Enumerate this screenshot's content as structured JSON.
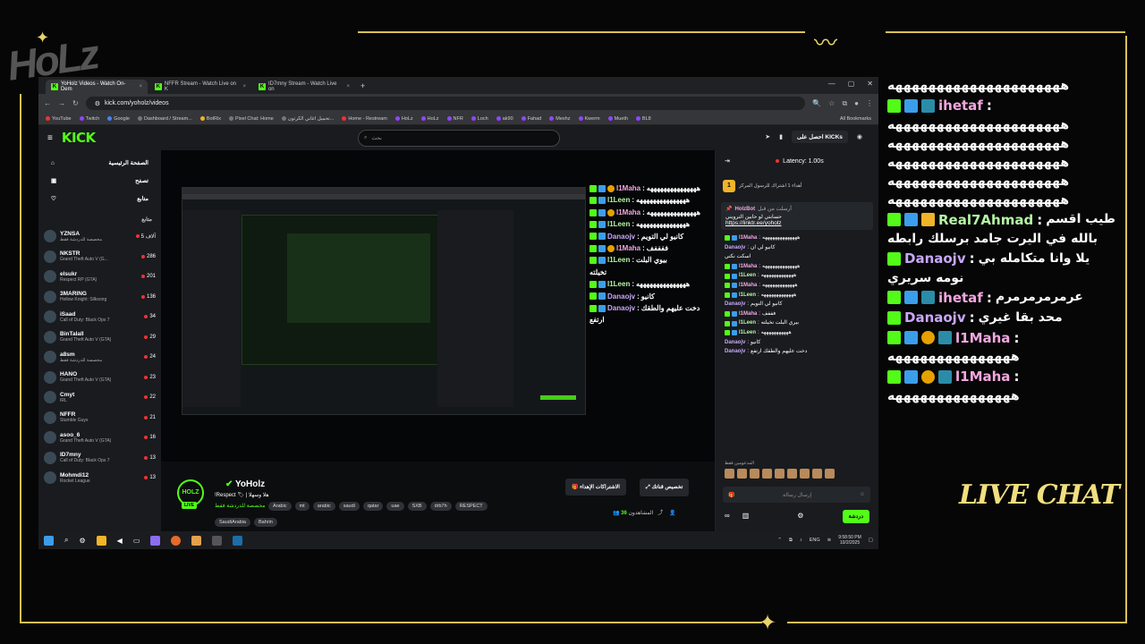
{
  "browser": {
    "tabs": [
      {
        "label": "YoHolz Videos - Watch On-Dem",
        "active": true
      },
      {
        "label": "NFFR Stream - Watch Live on K",
        "active": false
      },
      {
        "label": "ID7mny Stream - Watch Live on",
        "active": false
      }
    ],
    "url": "kick.com/yoholz/videos",
    "bookmarks": [
      "YouTube",
      "Twitch",
      "Google",
      "Dashboard / Stream...",
      "BotRix",
      "Pixel Chat: Home",
      "تحميل اغاني الكرتون...",
      "Home - Restream",
      "HoLz",
      "HoLz",
      "NFR",
      "Loch",
      "ak90",
      "Fahad",
      "Meshz",
      "Kwerm",
      "Mueth",
      "BL8"
    ],
    "all_bookmarks": "All Bookmarks"
  },
  "kick": {
    "logo": "KICK",
    "search_placeholder": "بحث",
    "get_kicks": "احصل على KICKs",
    "nav": {
      "home": "الصفحة الرئيسية",
      "browse": "تصفح",
      "following": "متابع"
    },
    "sidebar_title": "متابع",
    "channels": [
      {
        "name": "YZNSA",
        "cat": "مخصصة للدردشة فقط",
        "viewers": "5 آلاف"
      },
      {
        "name": "NKSTR",
        "cat": "Grand Theft Auto V (G...",
        "viewers": "286"
      },
      {
        "name": "elsukr",
        "cat": "Respect RP (GTA)",
        "viewers": "201"
      },
      {
        "name": "3MARING",
        "cat": "Hollow Knight: Silksong",
        "viewers": "136"
      },
      {
        "name": "iSaad",
        "cat": "Call of Duty: Black Ops 7",
        "viewers": "34"
      },
      {
        "name": "BinTalall",
        "cat": "Grand Theft Auto V (GTA)",
        "viewers": "29"
      },
      {
        "name": "a8sm",
        "cat": "مخصصة للدردشة فقط",
        "viewers": "24"
      },
      {
        "name": "HANO",
        "cat": "Grand Theft Auto V (GTA)",
        "viewers": "23"
      },
      {
        "name": "Cmyt",
        "cat": "IRL",
        "viewers": "22"
      },
      {
        "name": "NFFR",
        "cat": "Stumble Guys",
        "viewers": "21"
      },
      {
        "name": "asoo_6",
        "cat": "Grand Theft Auto V (GTA)",
        "viewers": "16"
      },
      {
        "name": "ID7mny",
        "cat": "Call of Duty: Black Ops 7",
        "viewers": "13"
      },
      {
        "name": "Mohmdi12",
        "cat": "Rocket League",
        "viewers": "13"
      }
    ]
  },
  "player_chat": [
    {
      "user": "l1Maha",
      "msg": "هههههههههههههههه"
    },
    {
      "user": "l1Leen",
      "msg": "هههههههههههههههه"
    },
    {
      "user": "l1Maha",
      "msg": "هههههههههههههههه"
    },
    {
      "user": "l1Leen",
      "msg": "هههههههههههههههه"
    },
    {
      "user": "Danaojv",
      "msg": "كانيو لي التويم"
    },
    {
      "user": "l1Maha",
      "msg": "ففففف"
    },
    {
      "user": "l1Leen",
      "msg": "بيوي البلت"
    },
    {
      "user": "",
      "msg": "تخيلته"
    },
    {
      "user": "l1Leen",
      "msg": "هههههههههههههههه"
    },
    {
      "user": "Danaojv",
      "msg": "كانيو"
    },
    {
      "user": "Danaojv",
      "msg": "دخت عليهم والطقك"
    },
    {
      "user": "",
      "msg": "ارتفع"
    }
  ],
  "stream": {
    "streamer": "YoHolz",
    "avatar_text": "HOLZ",
    "live": "LIVE",
    "title": "!Respect 🏷 | هلا وسهلا",
    "category": "مخصصة للدردشة فقط",
    "tags": [
      "Arabic",
      "mt",
      "arabic",
      "saudi",
      "qatar",
      "uae",
      "SXB",
      "drb7h",
      "RESPECT"
    ],
    "tags2": [
      "SaudiArabia",
      "Bahrin"
    ],
    "subscribe": "الاشتراكات الإهداء",
    "gift": "تخصيص قناتك",
    "viewers_label": "المشاهدون",
    "viewers": "36"
  },
  "chat_panel": {
    "latency": "Latency: 1.00s",
    "gift_count": "1",
    "gift_text": "أهداء 1 اشتراك للرسول المركز",
    "pinned_user": "HolzBot",
    "pinned_label": "أرسلت من قبل",
    "pinned_msg": "حسابتي لو حابين الترويني",
    "pinned_link": "https://linktr.ee/yoholz",
    "lines": [
      {
        "user": "l1Maha",
        "msg": "ههههههههههههههه"
      },
      {
        "user": "Danaojv",
        "msg": "كانيو لي ان"
      },
      {
        "user": "",
        "msg": "اسكت نكتي"
      },
      {
        "user": "l1Maha",
        "msg": "ههههههههههههههه"
      },
      {
        "user": "l1Leen",
        "msg": "هههههههههههههه"
      },
      {
        "user": "l1Maha",
        "msg": "هههههههههههههه"
      },
      {
        "user": "l1Leen",
        "msg": "هههههههههههههه"
      },
      {
        "user": "Danaojv",
        "msg": "كانيو لي التويم"
      },
      {
        "user": "l1Maha",
        "msg": "فففف"
      },
      {
        "user": "l1Leen",
        "msg": "بيري البلت تخيلته"
      },
      {
        "user": "l1Leen",
        "msg": "هههههههههههه"
      },
      {
        "user": "Danaojv",
        "msg": "كانيو"
      },
      {
        "user": "Danaojv",
        "msg": "دخت عليهم والطقك ارتفع"
      }
    ],
    "emote_label": "المدعومين فقط",
    "input_placeholder": "إرسال رسالة",
    "send": "دردشة"
  },
  "taskbar": {
    "lang": "ENG",
    "time": "9:58:50 PM",
    "date": "10/2/2025"
  },
  "live_chat": {
    "title": "LIVE CHAT",
    "lines": [
      {
        "user": "",
        "msg": "هههههههههههههههههههههه"
      },
      {
        "user": "ihetaf",
        "msg": ""
      },
      {
        "user": "",
        "msg": "هههههههههههههههههههههه"
      },
      {
        "user": "",
        "msg": "هههههههههههههههههههههه"
      },
      {
        "user": "",
        "msg": "هههههههههههههههههههههه"
      },
      {
        "user": "",
        "msg": "هههههههههههههههههههههه"
      },
      {
        "user": "",
        "msg": "هههههههههههههههههههههه"
      },
      {
        "user": "Real7Ahmad",
        "msg": "طيب اقسم"
      },
      {
        "user": "",
        "msg": "بالله في اليرت جامد برسلك رابطه"
      },
      {
        "user": "Danaojv",
        "msg": "يلا وانا متكامله بي"
      },
      {
        "user": "",
        "msg": "نومه سريري"
      },
      {
        "user": "ihetaf",
        "msg": "عرمرمرمرمرم"
      },
      {
        "user": "Danaojv",
        "msg": "محد بقا غيري"
      },
      {
        "user": "l1Maha",
        "msg": ""
      },
      {
        "user": "",
        "msg": "هههههههههههههههه"
      },
      {
        "user": "l1Maha",
        "msg": ""
      },
      {
        "user": "",
        "msg": "هههههههههههههههه"
      }
    ]
  }
}
